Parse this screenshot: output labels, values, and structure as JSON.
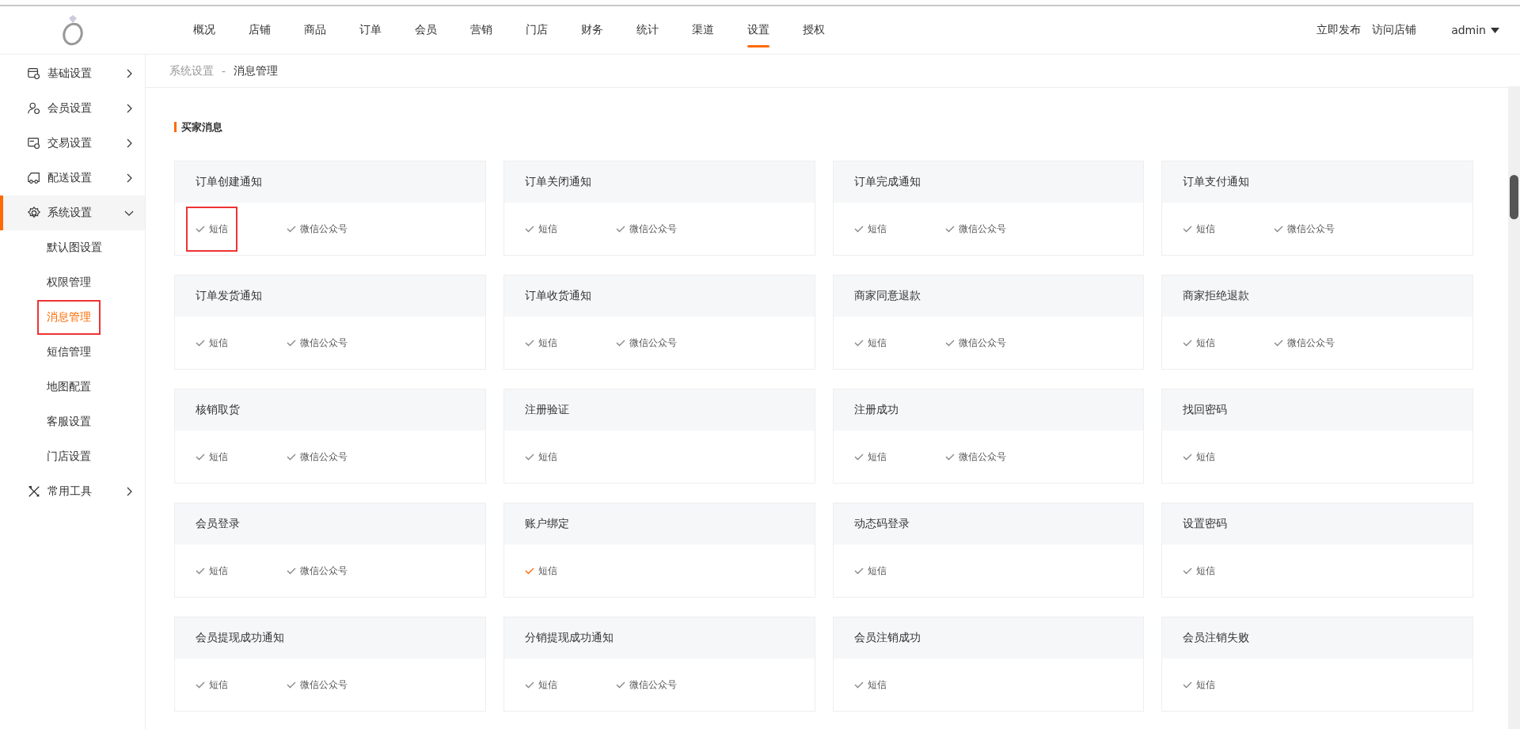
{
  "nav": {
    "items": [
      {
        "label": "概况",
        "selected": false
      },
      {
        "label": "店铺",
        "selected": false
      },
      {
        "label": "商品",
        "selected": false
      },
      {
        "label": "订单",
        "selected": false
      },
      {
        "label": "会员",
        "selected": false
      },
      {
        "label": "营销",
        "selected": false
      },
      {
        "label": "门店",
        "selected": false
      },
      {
        "label": "财务",
        "selected": false
      },
      {
        "label": "统计",
        "selected": false
      },
      {
        "label": "渠道",
        "selected": false
      },
      {
        "label": "设置",
        "selected": true
      },
      {
        "label": "授权",
        "selected": false
      }
    ],
    "actions": [
      "立即发布",
      "访问店铺"
    ],
    "user": "admin"
  },
  "sidebar": {
    "items": [
      {
        "label": "基础设置",
        "selected": false,
        "expanded": false
      },
      {
        "label": "会员设置",
        "selected": false,
        "expanded": false
      },
      {
        "label": "交易设置",
        "selected": false,
        "expanded": false
      },
      {
        "label": "配送设置",
        "selected": false,
        "expanded": false
      },
      {
        "label": "系统设置",
        "selected": true,
        "expanded": true,
        "children": [
          {
            "label": "默认图设置",
            "selected": false,
            "annotated": false
          },
          {
            "label": "权限管理",
            "selected": false,
            "annotated": false
          },
          {
            "label": "消息管理",
            "selected": true,
            "annotated": true
          },
          {
            "label": "短信管理",
            "selected": false,
            "annotated": false
          },
          {
            "label": "地图配置",
            "selected": false,
            "annotated": false
          },
          {
            "label": "客服设置",
            "selected": false,
            "annotated": false
          },
          {
            "label": "门店设置",
            "selected": false,
            "annotated": false
          }
        ]
      },
      {
        "label": "常用工具",
        "selected": false,
        "expanded": false
      }
    ]
  },
  "breadcrumb": [
    "系统设置",
    "-",
    "消息管理"
  ],
  "section_title": "买家消息",
  "cards": [
    {
      "title": "订单创建通知",
      "channels": [
        {
          "label": "短信",
          "active": false,
          "annotated": true
        },
        {
          "label": "微信公众号",
          "active": false,
          "annotated": false
        }
      ]
    },
    {
      "title": "订单关闭通知",
      "channels": [
        {
          "label": "短信",
          "active": false,
          "annotated": false
        },
        {
          "label": "微信公众号",
          "active": false,
          "annotated": false
        }
      ]
    },
    {
      "title": "订单完成通知",
      "channels": [
        {
          "label": "短信",
          "active": false,
          "annotated": false
        },
        {
          "label": "微信公众号",
          "active": false,
          "annotated": false
        }
      ]
    },
    {
      "title": "订单支付通知",
      "channels": [
        {
          "label": "短信",
          "active": false,
          "annotated": false
        },
        {
          "label": "微信公众号",
          "active": false,
          "annotated": false
        }
      ]
    },
    {
      "title": "订单发货通知",
      "channels": [
        {
          "label": "短信",
          "active": false,
          "annotated": false
        },
        {
          "label": "微信公众号",
          "active": false,
          "annotated": false
        }
      ]
    },
    {
      "title": "订单收货通知",
      "channels": [
        {
          "label": "短信",
          "active": false,
          "annotated": false
        },
        {
          "label": "微信公众号",
          "active": false,
          "annotated": false
        }
      ]
    },
    {
      "title": "商家同意退款",
      "channels": [
        {
          "label": "短信",
          "active": false,
          "annotated": false
        },
        {
          "label": "微信公众号",
          "active": false,
          "annotated": false
        }
      ]
    },
    {
      "title": "商家拒绝退款",
      "channels": [
        {
          "label": "短信",
          "active": false,
          "annotated": false
        },
        {
          "label": "微信公众号",
          "active": false,
          "annotated": false
        }
      ]
    },
    {
      "title": "核销取货",
      "channels": [
        {
          "label": "短信",
          "active": false,
          "annotated": false
        },
        {
          "label": "微信公众号",
          "active": false,
          "annotated": false
        }
      ]
    },
    {
      "title": "注册验证",
      "channels": [
        {
          "label": "短信",
          "active": false,
          "annotated": false
        }
      ]
    },
    {
      "title": "注册成功",
      "channels": [
        {
          "label": "短信",
          "active": false,
          "annotated": false
        },
        {
          "label": "微信公众号",
          "active": false,
          "annotated": false
        }
      ]
    },
    {
      "title": "找回密码",
      "channels": [
        {
          "label": "短信",
          "active": false,
          "annotated": false
        }
      ]
    },
    {
      "title": "会员登录",
      "channels": [
        {
          "label": "短信",
          "active": false,
          "annotated": false
        },
        {
          "label": "微信公众号",
          "active": false,
          "annotated": false
        }
      ]
    },
    {
      "title": "账户绑定",
      "channels": [
        {
          "label": "短信",
          "active": true,
          "annotated": false
        }
      ]
    },
    {
      "title": "动态码登录",
      "channels": [
        {
          "label": "短信",
          "active": false,
          "annotated": false
        }
      ]
    },
    {
      "title": "设置密码",
      "channels": [
        {
          "label": "短信",
          "active": false,
          "annotated": false
        }
      ]
    },
    {
      "title": "会员提现成功通知",
      "channels": [
        {
          "label": "短信",
          "active": false,
          "annotated": false
        },
        {
          "label": "微信公众号",
          "active": false,
          "annotated": false
        }
      ]
    },
    {
      "title": "分销提现成功通知",
      "channels": [
        {
          "label": "短信",
          "active": false,
          "annotated": false
        },
        {
          "label": "微信公众号",
          "active": false,
          "annotated": false
        }
      ]
    },
    {
      "title": "会员注销成功",
      "channels": [
        {
          "label": "短信",
          "active": false,
          "annotated": false
        }
      ]
    },
    {
      "title": "会员注销失败",
      "channels": [
        {
          "label": "短信",
          "active": false,
          "annotated": false
        }
      ]
    }
  ]
}
